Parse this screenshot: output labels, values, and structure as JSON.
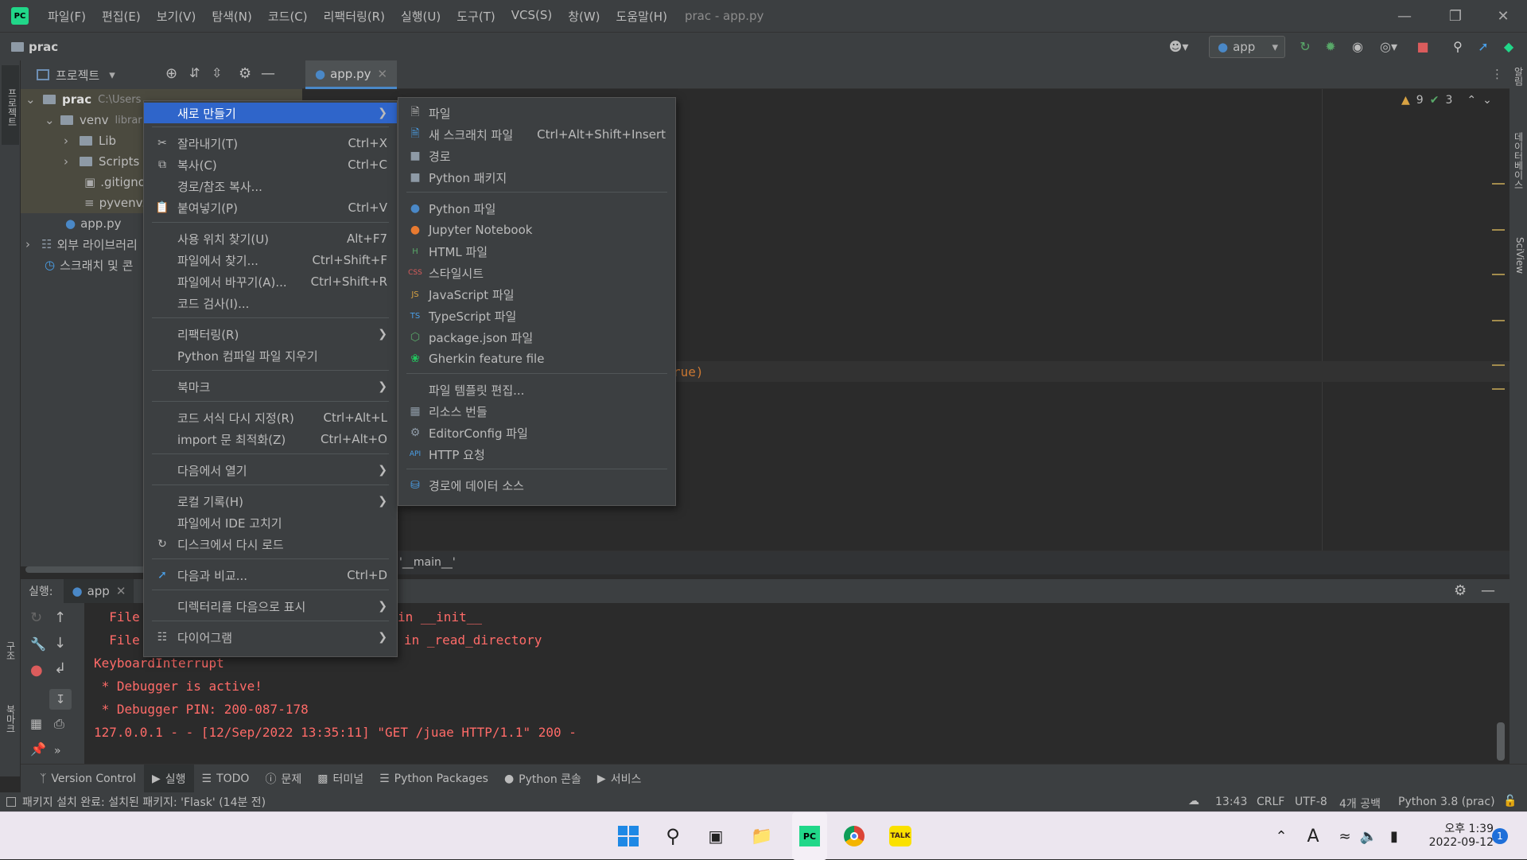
{
  "titlebar": {
    "menu": [
      "파일(F)",
      "편집(E)",
      "보기(V)",
      "탐색(N)",
      "코드(C)",
      "리팩터링(R)",
      "실행(U)",
      "도구(T)",
      "VCS(S)",
      "창(W)",
      "도움말(H)"
    ],
    "window_title": "prac - app.py"
  },
  "navbar": {
    "project": "prac",
    "run_config": "app"
  },
  "project_panel": {
    "title": "프로젝트",
    "left_strip_label": "프로젝트",
    "tree": [
      {
        "label": "prac",
        "hint": "C:\\Users"
      },
      {
        "label": "venv",
        "hint": "librar"
      },
      {
        "label": "Lib"
      },
      {
        "label": "Scripts"
      },
      {
        "label": ".gitigno"
      },
      {
        "label": "pyvenv."
      },
      {
        "label": "app.py"
      },
      {
        "label": "외부 라이브러리"
      },
      {
        "label": "스크래치 및 콘"
      }
    ]
  },
  "editor": {
    "tab": "app.py",
    "warnings": "9",
    "checks": "3",
    "visible_code": "rue)",
    "breadcrumb": "'__main__'"
  },
  "context_menu": {
    "items": [
      {
        "label": "새로 만들기",
        "shortcut": "",
        "submenu": true
      },
      {
        "label": "잘라내기(T)",
        "shortcut": "Ctrl+X"
      },
      {
        "label": "복사(C)",
        "shortcut": "Ctrl+C"
      },
      {
        "label": "경로/참조 복사...",
        "shortcut": ""
      },
      {
        "label": "붙여넣기(P)",
        "shortcut": "Ctrl+V"
      },
      {
        "label": "사용 위치 찾기(U)",
        "shortcut": "Alt+F7"
      },
      {
        "label": "파일에서 찾기...",
        "shortcut": "Ctrl+Shift+F"
      },
      {
        "label": "파일에서 바꾸기(A)...",
        "shortcut": "Ctrl+Shift+R"
      },
      {
        "label": "코드 검사(I)...",
        "shortcut": ""
      },
      {
        "label": "리팩터링(R)",
        "shortcut": "",
        "submenu": true
      },
      {
        "label": "Python 컴파일 파일 지우기",
        "shortcut": ""
      },
      {
        "label": "북마크",
        "shortcut": "",
        "submenu": true
      },
      {
        "label": "코드 서식 다시 지정(R)",
        "shortcut": "Ctrl+Alt+L"
      },
      {
        "label": "import 문 최적화(Z)",
        "shortcut": "Ctrl+Alt+O"
      },
      {
        "label": "다음에서 열기",
        "shortcut": "",
        "submenu": true
      },
      {
        "label": "로컬 기록(H)",
        "shortcut": "",
        "submenu": true
      },
      {
        "label": "파일에서 IDE 고치기",
        "shortcut": ""
      },
      {
        "label": "디스크에서 다시 로드",
        "shortcut": ""
      },
      {
        "label": "다음과 비교...",
        "shortcut": "Ctrl+D"
      },
      {
        "label": "디렉터리를 다음으로 표시",
        "shortcut": "",
        "submenu": true
      },
      {
        "label": "다이어그램",
        "shortcut": "",
        "submenu": true
      }
    ]
  },
  "submenu": {
    "items": [
      {
        "label": "파일",
        "shortcut": ""
      },
      {
        "label": "새 스크래치 파일",
        "shortcut": "Ctrl+Alt+Shift+Insert"
      },
      {
        "label": "경로",
        "shortcut": ""
      },
      {
        "label": "Python 패키지",
        "shortcut": ""
      },
      {
        "label": "Python 파일",
        "shortcut": ""
      },
      {
        "label": "Jupyter Notebook",
        "shortcut": ""
      },
      {
        "label": "HTML 파일",
        "shortcut": ""
      },
      {
        "label": "스타일시트",
        "shortcut": ""
      },
      {
        "label": "JavaScript 파일",
        "shortcut": ""
      },
      {
        "label": "TypeScript 파일",
        "shortcut": ""
      },
      {
        "label": "package.json 파일",
        "shortcut": ""
      },
      {
        "label": "Gherkin feature file",
        "shortcut": ""
      },
      {
        "label": "파일 템플릿 편집...",
        "shortcut": ""
      },
      {
        "label": "리소스 번들",
        "shortcut": ""
      },
      {
        "label": "EditorConfig 파일",
        "shortcut": ""
      },
      {
        "label": "HTTP 요청",
        "shortcut": ""
      },
      {
        "label": "경로에 데이터 소스",
        "shortcut": ""
      }
    ]
  },
  "run_panel": {
    "label": "실행:",
    "config": "app",
    "console": [
      "  File",
      "  File",
      "KeyboardInterrupt",
      " * Debugger is active!",
      " * Debugger PIN: 200-087-178",
      "127.0.0.1 - - [12/Sep/2022 13:35:11] \"GET /juae HTTP/1.1\" 200 -"
    ],
    "console_right": [
      "in __init__",
      "in _read_directory"
    ]
  },
  "bottom_tabs": [
    "Version Control",
    "실행",
    "TODO",
    "문제",
    "터미널",
    "Python Packages",
    "Python 콘솔",
    "서비스"
  ],
  "status": {
    "message": "패키지 설치 완료: 설치된 패키지: 'Flask' (14분 전)",
    "position": "13:43",
    "line_sep": "CRLF",
    "encoding": "UTF-8",
    "indent": "4개 공백",
    "interpreter": "Python 3.8 (prac)"
  },
  "right_strip": [
    "알림",
    "데이터베이스",
    "SciView"
  ],
  "left_strip_bottom": [
    "구조",
    "북마크"
  ],
  "taskbar": {
    "time": "오후 1:39",
    "date": "2022-09-12",
    "badge": "1",
    "ime": "A"
  },
  "colors": {
    "accent": "#2f65ca",
    "error": "#ff6b68",
    "panel": "#3c3f41",
    "editor": "#2b2b2b"
  }
}
